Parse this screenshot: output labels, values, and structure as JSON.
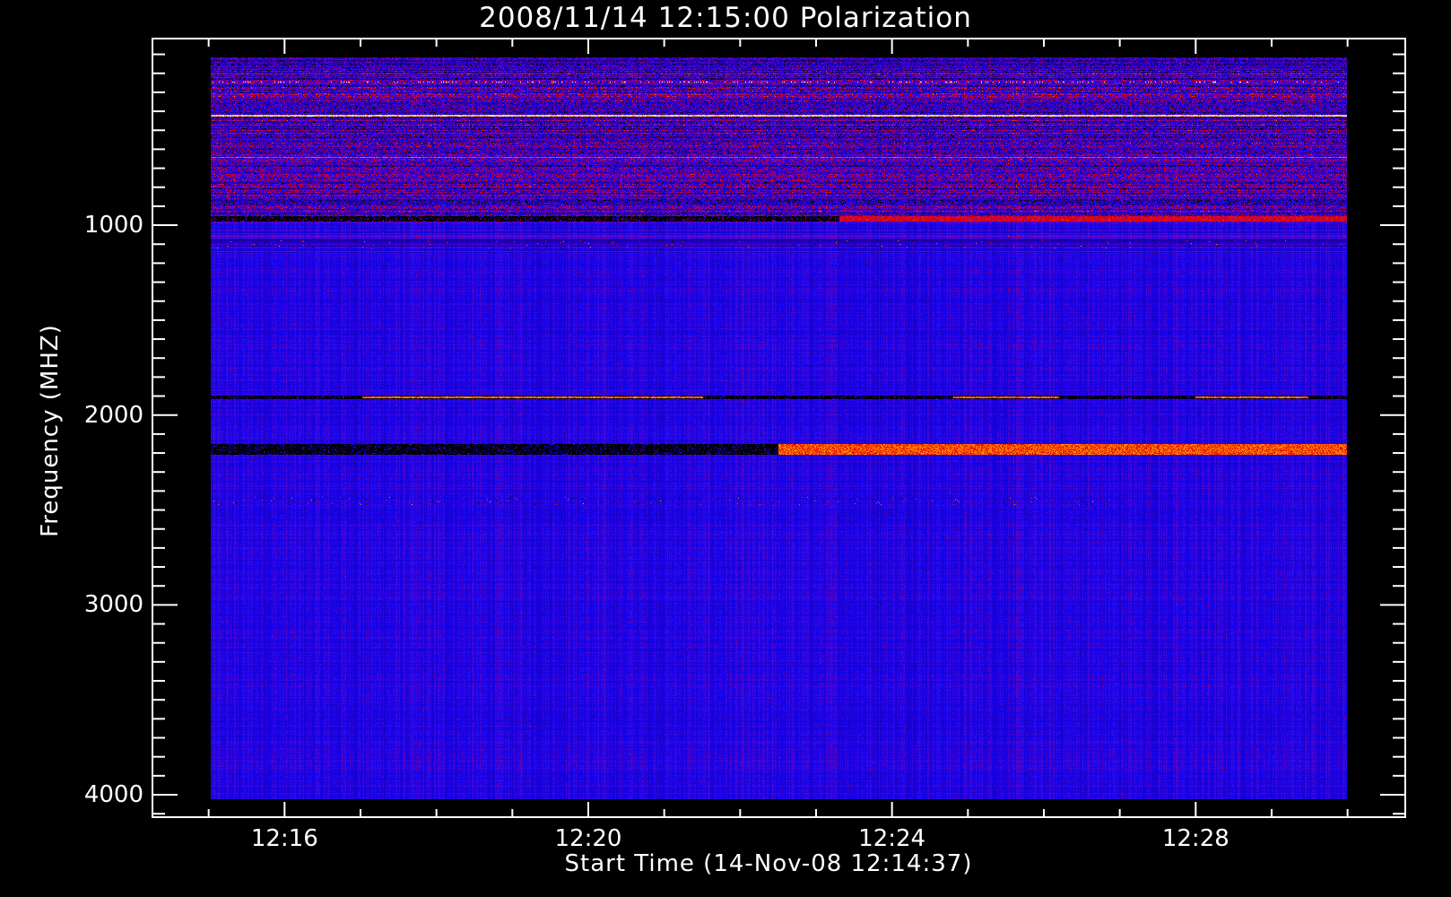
{
  "chart_data": {
    "type": "heatmap",
    "title": "2008/11/14 12:15:00 Polarization",
    "xlabel": "Start Time (14-Nov-08 12:14:37)",
    "ylabel": "Frequency (MHZ)",
    "x_unit": "minutes after 12:00",
    "xlim": [
      14.26,
      30.76
    ],
    "data_time_range": [
      15.0,
      30.0
    ],
    "ylim": [
      4118,
      17
    ],
    "data_freq_range": [
      116,
      4020
    ],
    "x_ticks": [
      {
        "value": 16,
        "label": "12:16"
      },
      {
        "value": 20,
        "label": "12:20"
      },
      {
        "value": 24,
        "label": "12:24"
      },
      {
        "value": 28,
        "label": "12:28"
      }
    ],
    "y_ticks": [
      {
        "value": 1000,
        "label": "1000"
      },
      {
        "value": 2000,
        "label": "2000"
      },
      {
        "value": 3000,
        "label": "3000"
      },
      {
        "value": 4000,
        "label": "4000"
      }
    ],
    "background_level": "blue (low polarization)",
    "features": [
      {
        "type": "noisy_region",
        "freq": [
          116,
          950
        ],
        "level": "mixed"
      },
      {
        "type": "band",
        "freq": 244,
        "width": 8,
        "t": [
          15,
          30
        ],
        "level": 1.0,
        "sparse": true
      },
      {
        "type": "band",
        "freq": 420,
        "width": 12,
        "t": [
          15,
          30
        ],
        "level": 0.9
      },
      {
        "type": "band",
        "freq": 640,
        "width": 8,
        "t": [
          15,
          30
        ],
        "level": 0.7
      },
      {
        "type": "band",
        "freq": 965,
        "width": 25,
        "t": [
          15,
          23.3
        ],
        "level": -1
      },
      {
        "type": "band",
        "freq": 965,
        "width": 25,
        "t": [
          23.3,
          30
        ],
        "level": 0.55
      },
      {
        "type": "spikes",
        "freq": 1100,
        "width": 40,
        "t": [
          15,
          30
        ]
      },
      {
        "type": "band",
        "freq": 1905,
        "width": 20,
        "t": [
          15,
          30
        ],
        "level": -0.8
      },
      {
        "type": "band",
        "freq": 1905,
        "width": 14,
        "t": [
          17,
          21.5
        ],
        "level": 0.75
      },
      {
        "type": "band",
        "freq": 1905,
        "width": 14,
        "t": [
          24.8,
          26.2
        ],
        "level": 0.75
      },
      {
        "type": "band",
        "freq": 1905,
        "width": 14,
        "t": [
          28,
          29.5
        ],
        "level": 0.75
      },
      {
        "type": "band",
        "freq": 2180,
        "width": 55,
        "t": [
          15,
          22.5
        ],
        "level": -1
      },
      {
        "type": "band",
        "freq": 2180,
        "width": 55,
        "t": [
          22.5,
          30
        ],
        "level": 0.72
      },
      {
        "type": "spikes",
        "freq": 2450,
        "width": 40,
        "t": [
          15,
          27
        ]
      }
    ],
    "colors": {
      "background": "#000000",
      "axes": "#ffffff",
      "low": "#1010f5",
      "mid": "#7a00b0",
      "high": "#e00000",
      "peak": "#ffff40"
    }
  }
}
